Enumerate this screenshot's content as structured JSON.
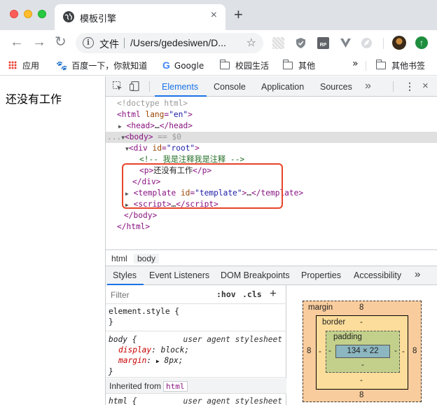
{
  "browser": {
    "tab_title": "模板引擎",
    "tab_close": "×",
    "new_tab": "+",
    "nav": {
      "back": "←",
      "forward": "→",
      "reload": "↻"
    },
    "omnibox": {
      "info": "i",
      "label": "文件",
      "url": "/Users/gedesiwen/D...",
      "star": "☆"
    },
    "ext_rp": "RP",
    "update_icon": "↑"
  },
  "bookmarks": {
    "items": [
      {
        "label": "应用"
      },
      {
        "label": "百度一下，你就知道"
      },
      {
        "label": "Google"
      },
      {
        "label": "校园生活"
      },
      {
        "label": "其他"
      }
    ],
    "overflow": "»",
    "other_label": "其他书签"
  },
  "page": {
    "text": "还没有工作"
  },
  "devtools": {
    "tabs": [
      "Elements",
      "Console",
      "Application",
      "Sources"
    ],
    "active_tab": "Elements",
    "more": "»",
    "kebab": "⋮",
    "close": "×",
    "dom": {
      "doctype": "<!doctype html>",
      "html_open_tag": "html",
      "html_lang_attr": "lang",
      "html_lang_val": "\"en\"",
      "head": "head",
      "body": "body",
      "body_suffix": "== $0",
      "div_attr": "id",
      "div_val": "\"root\"",
      "comment": "<!-- 我是注释我是注释 -->",
      "p_text": "还没有工作",
      "template_attr": "id",
      "template_val": "\"template\"",
      "ellipsis": "…"
    },
    "crumbs": [
      "html",
      "body"
    ],
    "subtabs": [
      "Styles",
      "Event Listeners",
      "DOM Breakpoints",
      "Properties",
      "Accessibility"
    ],
    "subtabs_more": "»",
    "filter_placeholder": "Filter",
    "hov": ":hov",
    "cls": ".cls",
    "plus": "+",
    "rules": {
      "element_style": "element.style {",
      "close_brace": "}",
      "body_selector": "body {",
      "source": "user agent stylesheet",
      "display_prop": "display",
      "display_val": "block;",
      "margin_prop": "margin",
      "margin_val": "8px;",
      "inherited_from": "Inherited from",
      "inherited_tag": "html",
      "html_selector": "html {"
    },
    "boxmodel": {
      "margin_label": "margin",
      "margin_top": "8",
      "margin_bottom": "8",
      "margin_left": "8",
      "margin_right": "8",
      "border_label": "border",
      "border_top": "-",
      "border_bottom": "-",
      "border_left": "-",
      "border_right": "-",
      "padding_label": "padding",
      "padding_top": "-",
      "padding_bottom": "-",
      "padding_left": "-",
      "padding_right": "-",
      "content": "134 × 22"
    }
  }
}
